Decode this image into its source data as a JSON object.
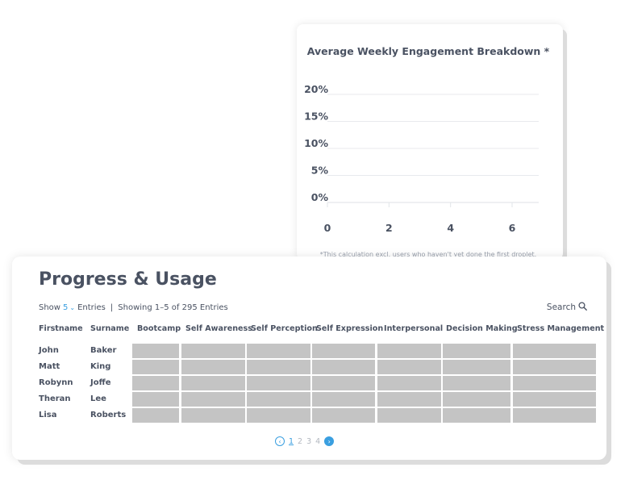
{
  "chart": {
    "title": "Average Weekly Engagement Breakdown *",
    "footnote": "*This calculation excl. users who haven't yet done the first droplet."
  },
  "chart_data": {
    "type": "line",
    "title": "Average Weekly Engagement Breakdown *",
    "xlabel": "",
    "ylabel": "",
    "x_ticks": [
      "0",
      "2",
      "4",
      "6"
    ],
    "y_ticks": [
      "0%",
      "5%",
      "10%",
      "15%",
      "20%"
    ],
    "xlim": [
      0,
      6
    ],
    "ylim": [
      0,
      20
    ],
    "grid": true,
    "series": []
  },
  "table": {
    "title": "Progress & Usage",
    "show_label": "Show",
    "show_value": "5",
    "entries_label": "Entries",
    "separator": "|",
    "showing_text": "Showing 1–5 of 295 Entries",
    "search_label": "Search",
    "columns": [
      "Firstname",
      "Surname",
      "Bootcamp",
      "Self Awareness",
      "Self Perception",
      "Self Expression",
      "Interpersonal",
      "Decision Making",
      "Stress Management"
    ],
    "rows": [
      {
        "first": "John",
        "last": "Baker"
      },
      {
        "first": "Matt",
        "last": "King"
      },
      {
        "first": "Robynn",
        "last": "Joffe"
      },
      {
        "first": "Theran",
        "last": "Lee"
      },
      {
        "first": "Lisa",
        "last": "Roberts"
      }
    ],
    "pages": [
      "1",
      "2",
      "3",
      "4"
    ],
    "current_page": "1"
  },
  "colors": {
    "accent": "#3a9fe0",
    "text": "#4a5262",
    "placeholder_bar": "#c4c4c4"
  },
  "icons": {
    "search": "search-icon",
    "prev": "chevron-left-icon",
    "next": "chevron-right-icon",
    "dropdown": "chevron-down-icon"
  }
}
